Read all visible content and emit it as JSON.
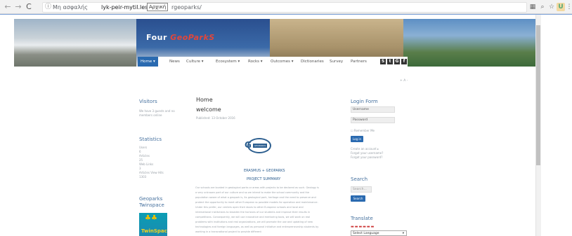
{
  "browser": {
    "insecure_label": "Μη ασφαλής",
    "host": "lyk-peir-mytil.les.s",
    "tooltip": "Αρχική",
    "path": "rgeoparks/"
  },
  "banner": {
    "logo_main": "Four",
    "logo_accent": "GeoParkS"
  },
  "menu": {
    "items": [
      "Home ▾",
      "News",
      "Culture ▾",
      "Ecosystem ▾",
      "Rocks ▾",
      "Outcomes ▾",
      "Dictionaries",
      "Survey",
      "Partners"
    ]
  },
  "social": [
    "S",
    "t",
    "G",
    "f"
  ],
  "font_size_ctrl": "+ A -",
  "left": {
    "visitors_title": "Visitors",
    "visitors_text": [
      "We have 3 guests and no",
      "members online"
    ],
    "statistics_title": "Statistics",
    "stats": [
      "Users",
      "6",
      "Articles",
      "25",
      "Web Links",
      "3",
      "Articles View Hits",
      "1303"
    ],
    "twinspace_title": [
      "Geoparks",
      "Twinspace"
    ],
    "twin_label": "TwinSpace"
  },
  "main": {
    "title": "Home",
    "subtitle": "welcome",
    "published": "Published: 13 October 2016",
    "logo_text": "GEOPARKS",
    "proj_line1": "ERASMUS + GEOPARKS",
    "proj_line2": "PROJECT SUMMARY",
    "body": "Our schools are located in geological parks or areas with projects to be declared as such. Geology is a very unknown part of our culture and so we intend to make the school community and the population aware of what a geopark is, its geological park, heritage and the need to preserve and protect the opportunity to meet other European ss possible models for operation and maintenance. Under this prefer, our centers open their doors to other European schools and local and international institutions to broaden the horizons of our students and improve their results in competitions. Consequently, we will use innovative and mentoring tools, we will work on real problems with institutions and real organizations, we will promote the use and updating of new technologies and foreign languages, as well as personal initiative and entrepreneurship students by working in a transnational project to provide different"
  },
  "right": {
    "login_title": "Login Form",
    "username": "Username",
    "password": "Password",
    "remember": "Remember Me",
    "login_btn": "Log in",
    "links": [
      "Create an account ▸",
      "Forgot your username?",
      "Forgot your password?"
    ],
    "search_title": "Search",
    "search_placeholder": "Search...",
    "search_btn": "Search",
    "translate_title": "Translate",
    "select_language": "Select Language"
  }
}
